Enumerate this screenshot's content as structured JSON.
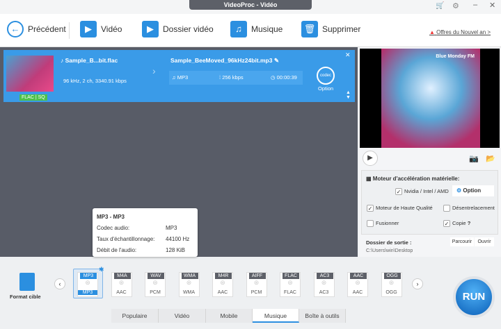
{
  "window": {
    "title": "VideoProc - Vidéo"
  },
  "toolbar": {
    "back": "Précédent",
    "video": "Vidéo",
    "folder": "Dossier vidéo",
    "music": "Musique",
    "delete": "Supprimer",
    "offer": "Offres du Nouvel an >"
  },
  "file": {
    "source_name": "Sample_B...bit.flac",
    "source_info": "96 kHz, 2 ch, 3340.91 kbps",
    "badge": "FLAC | SQ",
    "output_name": "Sample_BeeMoved_96kHz24bit.mp3",
    "format": "MP3",
    "bitrate": "256 kbps",
    "duration": "00:00:39",
    "codec_label": "codec",
    "option": "Option"
  },
  "preview": {
    "art_text": "Blue Monday FM"
  },
  "settings": {
    "hw_title": "Moteur d'accélération matérielle:",
    "hw_option": "Nvidia / Intel / AMD",
    "hw_checked": true,
    "option_btn": "Option",
    "hq": "Moteur de Haute Qualité",
    "hq_checked": true,
    "deint": "Désentrelacement",
    "deint_checked": false,
    "merge": "Fusionner",
    "merge_checked": false,
    "copy": "Copie",
    "copy_checked": true,
    "help": "?"
  },
  "output": {
    "label": "Dossier de sortie :",
    "browse": "Parcourir",
    "open": "Ouvrir",
    "path": "C:\\Users\\win\\Desktop"
  },
  "tooltip": {
    "title": "MP3 - MP3",
    "rows": [
      {
        "k": "Codec audio:",
        "v": "MP3"
      },
      {
        "k": "Taux d'échantillonnage:",
        "v": "44100 Hz"
      },
      {
        "k": "Débit de l'audio:",
        "v": "128 KiB"
      }
    ]
  },
  "target": {
    "label": "Format cible"
  },
  "formats": [
    {
      "t": "MP3",
      "b": "MP3"
    },
    {
      "t": "M4A",
      "b": "AAC"
    },
    {
      "t": "WAV",
      "b": "PCM"
    },
    {
      "t": "WMA",
      "b": "WMA"
    },
    {
      "t": "M4R",
      "b": "AAC"
    },
    {
      "t": "AIFF",
      "b": "PCM"
    },
    {
      "t": "FLAC",
      "b": "FLAC"
    },
    {
      "t": "AC3",
      "b": "AC3"
    },
    {
      "t": "AAC",
      "b": "AAC"
    },
    {
      "t": "OGG",
      "b": "OGG"
    }
  ],
  "tabs": [
    "Populaire",
    "Vidéo",
    "Mobile",
    "Musique",
    "Boîte à outils"
  ],
  "active_tab": "Musique",
  "run": "RUN"
}
